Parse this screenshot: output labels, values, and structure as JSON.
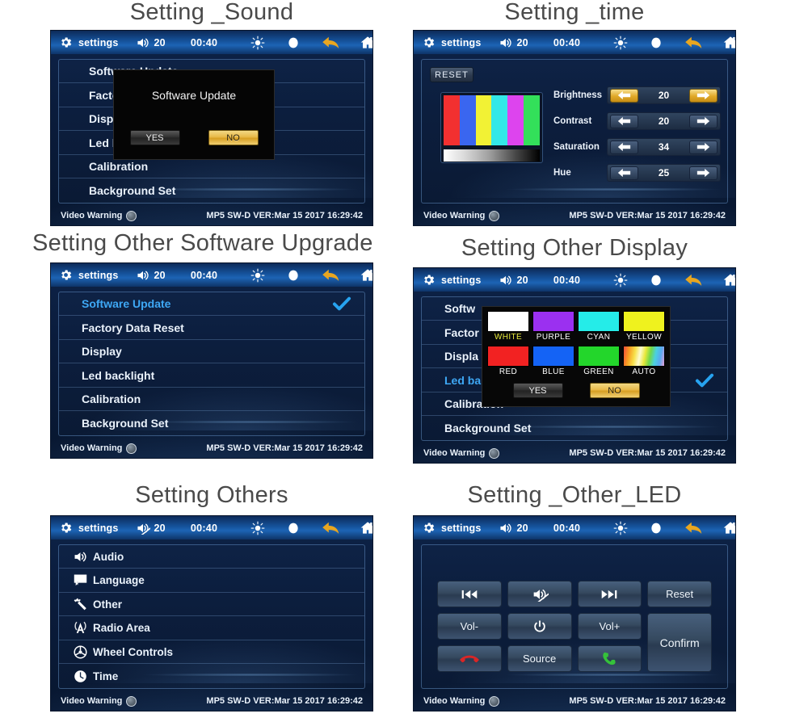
{
  "statusbar": {
    "settings_label": "settings",
    "volume": "20",
    "time": "00:40",
    "icons": [
      "gear-icon",
      "volume-icon",
      "brightness-icon",
      "moon-icon",
      "back-arrow-icon",
      "home-icon"
    ]
  },
  "footer": {
    "warning_label": "Video Warning",
    "version": "MP5 SW-D VER:Mar 15 2017 16:29:42"
  },
  "panels": [
    {
      "title": "Setting _Sound",
      "menu": [
        {
          "label": "Software Update",
          "selected": false
        },
        {
          "label": "Factory Data Reset",
          "selected": false
        },
        {
          "label": "Display",
          "selected": false
        },
        {
          "label": "Led backlight",
          "selected": false
        },
        {
          "label": "Calibration",
          "selected": false
        },
        {
          "label": "Background Set",
          "selected": false
        }
      ],
      "dialog": {
        "title": "Software Update",
        "yes_label": "YES",
        "no_label": "NO",
        "no_highlighted": true
      }
    },
    {
      "title": "Setting _time",
      "reset_label": "RESET",
      "testpattern_colors": [
        "#f23030",
        "#3a66f0",
        "#f2f234",
        "#33e8e8",
        "#dd44ee",
        "#33e05a"
      ],
      "adjustments": [
        {
          "label": "Brightness",
          "value": "20",
          "highlighted": true
        },
        {
          "label": "Contrast",
          "value": "20",
          "highlighted": false
        },
        {
          "label": "Saturation",
          "value": "34",
          "highlighted": false
        },
        {
          "label": "Hue",
          "value": "25",
          "highlighted": false
        }
      ]
    },
    {
      "title": "Setting Other Software Upgrade",
      "menu": [
        {
          "label": "Software Update",
          "selected": true,
          "checked": true
        },
        {
          "label": "Factory Data Reset",
          "selected": false
        },
        {
          "label": "Display",
          "selected": false
        },
        {
          "label": "Led backlight",
          "selected": false
        },
        {
          "label": "Calibration",
          "selected": false
        },
        {
          "label": "Background Set",
          "selected": false
        }
      ]
    },
    {
      "title": "Setting Other Display",
      "menu": [
        {
          "label": "Softw",
          "selected": false
        },
        {
          "label": "Factor",
          "selected": false
        },
        {
          "label": "Displa",
          "selected": false
        },
        {
          "label": "Led ba",
          "selected": true,
          "checked": true
        },
        {
          "label": "Calibration",
          "selected": false
        },
        {
          "label": "Background Set",
          "selected": false
        }
      ],
      "color_dialog": {
        "swatches": [
          {
            "name": "WHITE",
            "color": "#ffffff",
            "selected": true
          },
          {
            "name": "PURPLE",
            "color": "#9b30f0",
            "selected": false
          },
          {
            "name": "CYAN",
            "color": "#25ece8",
            "selected": false
          },
          {
            "name": "YELLOW",
            "color": "#eff21e",
            "selected": false
          },
          {
            "name": "RED",
            "color": "#f22222",
            "selected": false
          },
          {
            "name": "BLUE",
            "color": "#1463f5",
            "selected": false
          },
          {
            "name": "GREEN",
            "color": "#23d62b",
            "selected": false
          },
          {
            "name": "AUTO",
            "color": "auto-rainbow",
            "selected": false
          }
        ],
        "yes_label": "YES",
        "no_label": "NO",
        "no_highlighted": true
      }
    },
    {
      "title": "Setting Others",
      "muted": true,
      "menu": [
        {
          "label": "Audio",
          "icon": "speaker-icon"
        },
        {
          "label": "Language",
          "icon": "chat-bubble-icon"
        },
        {
          "label": "Other",
          "icon": "wrench-icon"
        },
        {
          "label": "Radio Area",
          "icon": "antenna-icon"
        },
        {
          "label": "Wheel Controls",
          "icon": "steering-wheel-icon"
        },
        {
          "label": "Time",
          "icon": "clock-icon"
        }
      ]
    },
    {
      "title": "Setting _Other_LED",
      "keys": [
        {
          "label": "",
          "icon": "prev-track-icon"
        },
        {
          "label": "",
          "icon": "mute-icon"
        },
        {
          "label": "",
          "icon": "next-track-icon"
        },
        {
          "label": "Reset",
          "icon": ""
        },
        {
          "label": "Vol-",
          "icon": ""
        },
        {
          "label": "",
          "icon": "power-icon"
        },
        {
          "label": "Vol+",
          "icon": ""
        },
        {
          "label": "Confirm",
          "icon": ""
        },
        {
          "label": "",
          "icon": "hangup-icon"
        },
        {
          "label": "Source",
          "icon": ""
        },
        {
          "label": "",
          "icon": "call-icon"
        }
      ]
    }
  ],
  "colors": {
    "accent_blue": "#3ea8f5",
    "gold": "#e8b948",
    "screen_bg": "#0b1c38",
    "statusbar_blue": "#1d64b4",
    "check_blue": "#27a3f0"
  }
}
